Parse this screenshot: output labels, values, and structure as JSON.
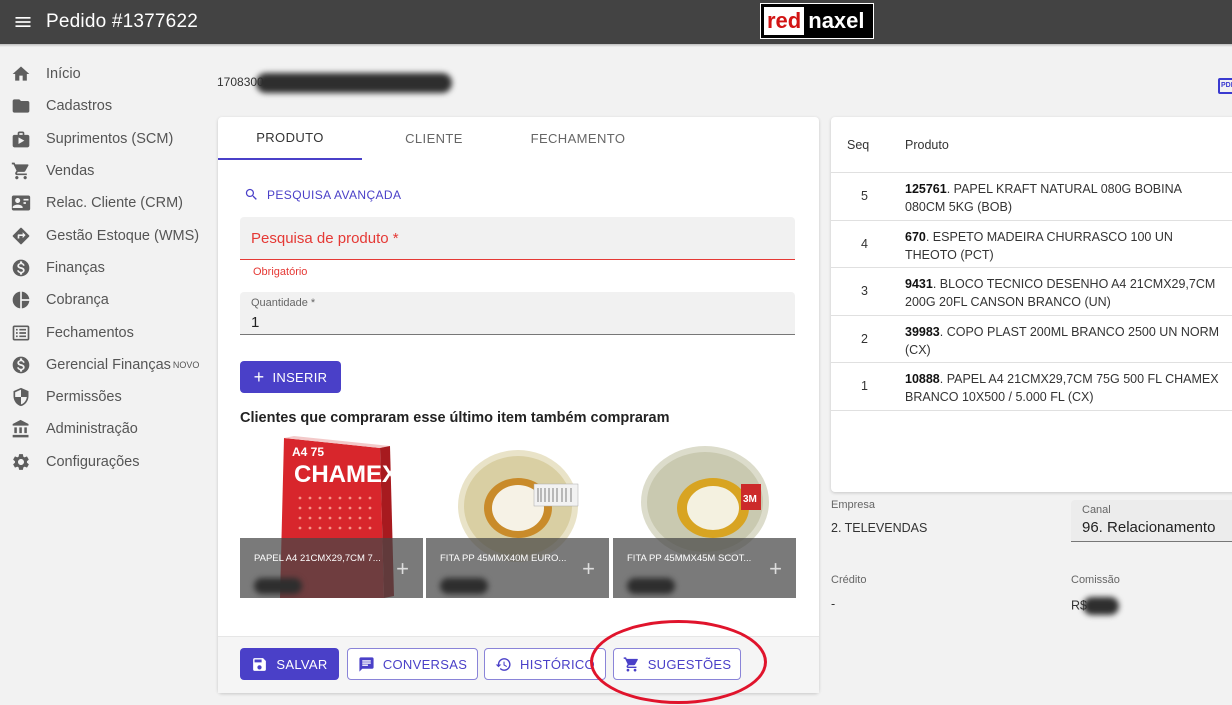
{
  "header": {
    "title": "Pedido #1377622",
    "logo_part1": "red",
    "logo_part2": "naxel"
  },
  "sidebar": {
    "items": [
      {
        "label": "Início",
        "icon": "home-icon"
      },
      {
        "label": "Cadastros",
        "icon": "folder-icon"
      },
      {
        "label": "Suprimentos (SCM)",
        "icon": "supply-icon"
      },
      {
        "label": "Vendas",
        "icon": "cart-icon"
      },
      {
        "label": "Relac. Cliente (CRM)",
        "icon": "contact-card-icon"
      },
      {
        "label": "Gestão Estoque (WMS)",
        "icon": "directions-icon"
      },
      {
        "label": "Finanças",
        "icon": "dollar-icon"
      },
      {
        "label": "Cobrança",
        "icon": "pie-chart-icon"
      },
      {
        "label": "Fechamentos",
        "icon": "list-icon"
      },
      {
        "label": "Gerencial Finanças",
        "badge": "NOVO",
        "icon": "dollar-icon"
      },
      {
        "label": "Permissões",
        "icon": "shield-icon"
      },
      {
        "label": "Administração",
        "icon": "bank-icon"
      },
      {
        "label": "Configurações",
        "icon": "gear-icon"
      }
    ]
  },
  "order": {
    "code_prefix": "1708300"
  },
  "tabs": [
    "PRODUTO",
    "CLIENTE",
    "FECHAMENTO"
  ],
  "product_form": {
    "advanced_search": "PESQUISA AVANÇADA",
    "search_placeholder": "Pesquisa de produto *",
    "search_hint": "Obrigatório",
    "qty_label": "Quantidade *",
    "qty_value": "1",
    "insert_button": "INSERIR"
  },
  "recommendations": {
    "title": "Clientes que compraram esse último item também compraram",
    "items": [
      {
        "name": "PAPEL A4 21CMX29,7CM 7..."
      },
      {
        "name": "FITA PP 45MMX40M EURO..."
      },
      {
        "name": "FITA PP 45MMX45M SCOT..."
      }
    ]
  },
  "actions": {
    "save": "SALVAR",
    "conversations": "CONVERSAS",
    "history": "HISTÓRICO",
    "suggestions": "SUGESTÕES"
  },
  "items_table": {
    "col_seq": "Seq",
    "col_product": "Produto",
    "rows": [
      {
        "seq": "5",
        "code": "125761",
        "desc": ". PAPEL KRAFT NATURAL 080G BOBINA 080CM 5KG (BOB)"
      },
      {
        "seq": "4",
        "code": "670",
        "desc": ". ESPETO MADEIRA CHURRASCO 100 UN THEOTO (PCT)"
      },
      {
        "seq": "3",
        "code": "9431",
        "desc": ". BLOCO TECNICO DESENHO A4 21CMX29,7CM 200G 20FL CANSON BRANCO (UN)"
      },
      {
        "seq": "2",
        "code": "39983",
        "desc": ". COPO PLAST 200ML BRANCO 2500 UN NORM (CX)"
      },
      {
        "seq": "1",
        "code": "10888",
        "desc": ". PAPEL A4 21CMX29,7CM 75G 500 FL CHAMEX BRANCO 10X500 / 5.000 FL (CX)"
      }
    ]
  },
  "order_info": {
    "empresa_label": "Empresa",
    "empresa_value": "2. TELEVENDAS",
    "canal_label": "Canal",
    "canal_value": "96. Relacionamento",
    "credito_label": "Crédito",
    "credito_value": "-",
    "comissao_label": "Comissão",
    "comissao_prefix": "R$"
  },
  "colors": {
    "primary": "#4a40c8",
    "error": "#e53935",
    "topbar": "#434343",
    "highlight": "#e0142c"
  }
}
